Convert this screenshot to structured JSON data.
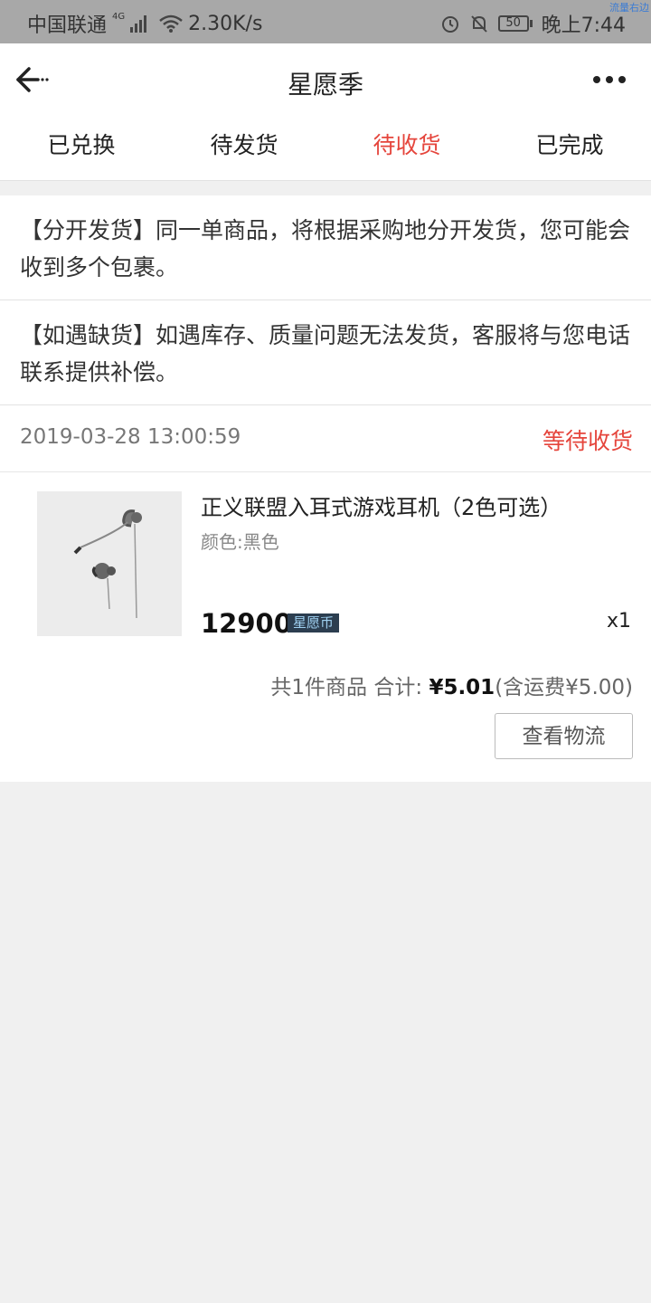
{
  "status_bar": {
    "carrier": "中国联通",
    "network": "4G",
    "speed": "2.30K/s",
    "battery": "50",
    "time": "晚上7:44",
    "corner_label": "流量右边"
  },
  "header": {
    "title": "星愿季"
  },
  "tabs": [
    {
      "label": "已兑换"
    },
    {
      "label": "待发货"
    },
    {
      "label": "待收货",
      "active": true
    },
    {
      "label": "已完成"
    }
  ],
  "notices": [
    {
      "text": "【分开发货】同一单商品，将根据采购地分开发货，您可能会收到多个包裹。"
    },
    {
      "text": "【如遇缺货】如遇库存、质量问题无法发货，客服将与您电话联系提供补偿。"
    }
  ],
  "order": {
    "datetime": "2019-03-28 13:00:59",
    "status": "等待收货",
    "product": {
      "name": "正义联盟入耳式游戏耳机（2色可选）",
      "variant": "颜色:黑色",
      "price": "12900",
      "currency_badge": "星愿币",
      "quantity": "x1"
    },
    "summary": {
      "count_text": "共1件商品 合计:",
      "total": "¥5.01",
      "shipping": "(含运费¥5.00)"
    },
    "logistics_button": "查看物流"
  },
  "colors": {
    "accent": "#e5453c",
    "status_bar_bg": "#a8a8a8"
  }
}
